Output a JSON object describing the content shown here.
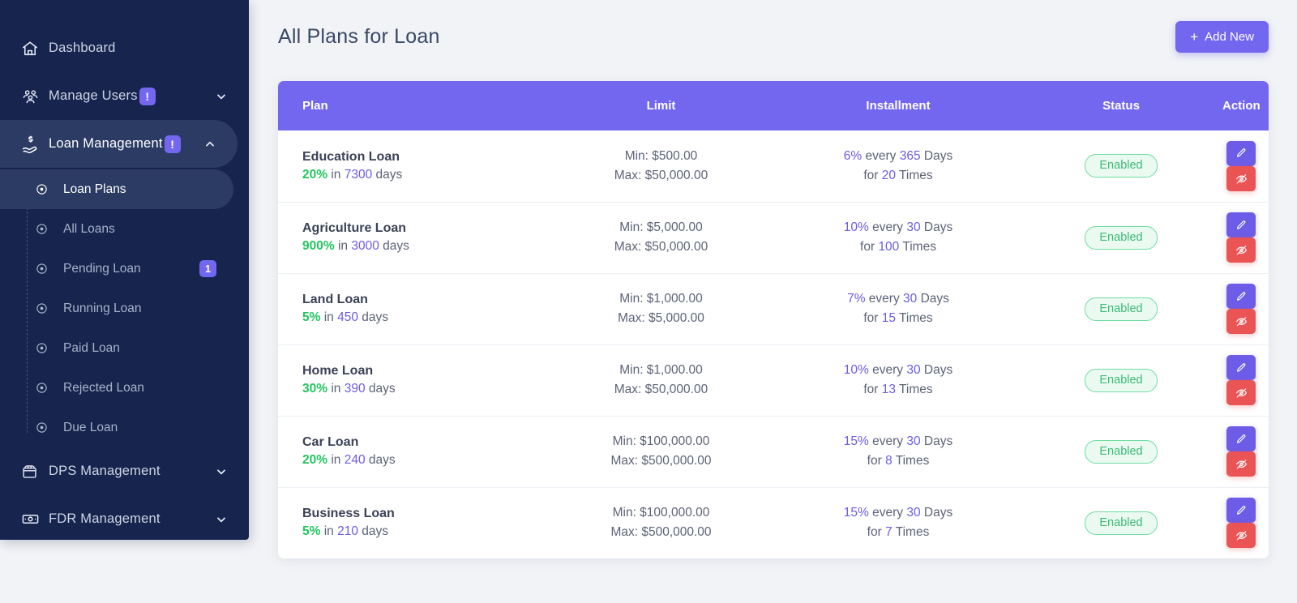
{
  "sidebar": {
    "items": [
      {
        "label": "Dashboard",
        "icon": "home-icon",
        "active": false,
        "has_badge": false,
        "chevron": ""
      },
      {
        "label": "Manage Users",
        "icon": "users-icon",
        "active": false,
        "has_badge": true,
        "badge": "!",
        "chevron": "down"
      },
      {
        "label": "Loan Management",
        "icon": "hand-money-icon",
        "active": true,
        "has_badge": true,
        "badge": "!",
        "chevron": "up"
      }
    ],
    "submenu": [
      {
        "label": "Loan Plans",
        "active": true,
        "count": ""
      },
      {
        "label": "All Loans",
        "active": false,
        "count": ""
      },
      {
        "label": "Pending Loan",
        "active": false,
        "count": "1"
      },
      {
        "label": "Running Loan",
        "active": false,
        "count": ""
      },
      {
        "label": "Paid Loan",
        "active": false,
        "count": ""
      },
      {
        "label": "Rejected Loan",
        "active": false,
        "count": ""
      },
      {
        "label": "Due Loan",
        "active": false,
        "count": ""
      }
    ],
    "items_bottom": [
      {
        "label": "DPS Management",
        "icon": "box-icon",
        "active": false,
        "has_badge": false,
        "chevron": "down"
      },
      {
        "label": "FDR Management",
        "icon": "banknote-icon",
        "active": false,
        "has_badge": false,
        "chevron": "down"
      }
    ]
  },
  "header": {
    "title": "All Plans for Loan",
    "add_new_label": "Add New",
    "add_new_plus": "+"
  },
  "table": {
    "columns": [
      "Plan",
      "Limit",
      "Installment",
      "Status",
      "Action"
    ],
    "rows": [
      {
        "plan_name": "Education Loan",
        "rate": "20%",
        "in": "in",
        "days": "7300",
        "days_word": "days",
        "min": "Min: $500.00",
        "max": "Max: $50,000.00",
        "inst_pct": "6%",
        "every": "every",
        "inst_days": "365",
        "days_label": "Days",
        "for": "for",
        "times": "20",
        "times_label": "Times",
        "status": "Enabled"
      },
      {
        "plan_name": "Agriculture Loan",
        "rate": "900%",
        "in": "in",
        "days": "3000",
        "days_word": "days",
        "min": "Min: $5,000.00",
        "max": "Max: $50,000.00",
        "inst_pct": "10%",
        "every": "every",
        "inst_days": "30",
        "days_label": "Days",
        "for": "for",
        "times": "100",
        "times_label": "Times",
        "status": "Enabled"
      },
      {
        "plan_name": "Land Loan",
        "rate": "5%",
        "in": "in",
        "days": "450",
        "days_word": "days",
        "min": "Min: $1,000.00",
        "max": "Max: $5,000.00",
        "inst_pct": "7%",
        "every": "every",
        "inst_days": "30",
        "days_label": "Days",
        "for": "for",
        "times": "15",
        "times_label": "Times",
        "status": "Enabled"
      },
      {
        "plan_name": "Home Loan",
        "rate": "30%",
        "in": "in",
        "days": "390",
        "days_word": "days",
        "min": "Min: $1,000.00",
        "max": "Max: $50,000.00",
        "inst_pct": "10%",
        "every": "every",
        "inst_days": "30",
        "days_label": "Days",
        "for": "for",
        "times": "13",
        "times_label": "Times",
        "status": "Enabled"
      },
      {
        "plan_name": "Car Loan",
        "rate": "20%",
        "in": "in",
        "days": "240",
        "days_word": "days",
        "min": "Min: $100,000.00",
        "max": "Max: $500,000.00",
        "inst_pct": "15%",
        "every": "every",
        "inst_days": "30",
        "days_label": "Days",
        "for": "for",
        "times": "8",
        "times_label": "Times",
        "status": "Enabled"
      },
      {
        "plan_name": "Business Loan",
        "rate": "5%",
        "in": "in",
        "days": "210",
        "days_word": "days",
        "min": "Min: $100,000.00",
        "max": "Max: $500,000.00",
        "inst_pct": "15%",
        "every": "every",
        "inst_days": "30",
        "days_label": "Days",
        "for": "for",
        "times": "7",
        "times_label": "Times",
        "status": "Enabled"
      }
    ],
    "action_icons": [
      "edit-pencil-icon",
      "eye-off-icon"
    ]
  },
  "colors": {
    "sidebar_bg": "#16244e",
    "sidebar_active": "#2b3b63",
    "accent_purple": "#7367f0",
    "status_green": "#3dbb77",
    "danger_red": "#ea5455",
    "value_green": "#22c55e",
    "value_purple": "#6c5ce7",
    "page_bg": "#f1f3f6"
  }
}
